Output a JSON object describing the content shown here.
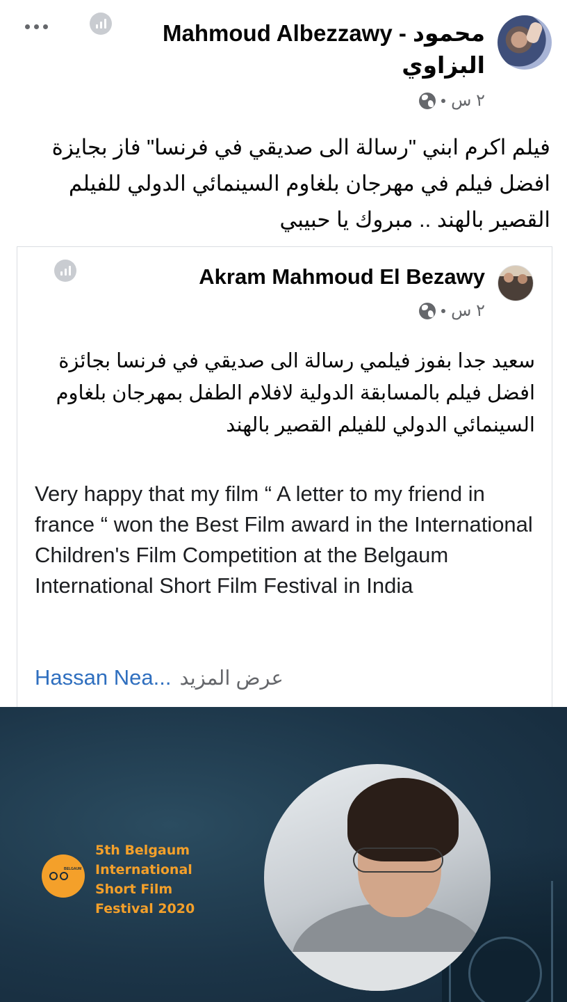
{
  "post": {
    "author_line1": "Mahmoud Albezzawy - محمود",
    "author_line2": "البزاوي",
    "time": "٢ س",
    "text": "فيلم اكرم ابني \"رسالة الى صديقي في فرنسا\" فاز بجايزة افضل فيلم في مهرجان بلغاوم السينمائي الدولي للفيلم القصير بالهند .. مبروك يا حبيبي"
  },
  "shared_post": {
    "author": "Akram Mahmoud El Bezawy",
    "time": "٢ س",
    "text_ar": "سعيد جدا بفوز فيلمي رسالة الى صديقي في فرنسا بجائزة افضل فيلم بالمسابقة الدولية لافلام الطفل بمهرجان بلغاوم السينمائي الدولي للفيلم القصير بالهند",
    "text_en": "Very happy that my film “ A letter to my friend in france “ won the Best Film award in the International Children's Film Competition at the Belgaum International Short Film Festival in India",
    "tagged_preview": "Hassan Nea...",
    "see_more": "عرض المزيد"
  },
  "festival_image": {
    "logo_text": "BELGAUM",
    "title_lines": [
      "5th Belgaum",
      "International",
      "Short Film",
      "Festival 2020"
    ],
    "accent_color": "#f4a02a",
    "background_color": "#1c3548"
  },
  "icons": {
    "more": "more-options-icon",
    "insights": "insights-icon",
    "privacy": "globe-icon"
  }
}
